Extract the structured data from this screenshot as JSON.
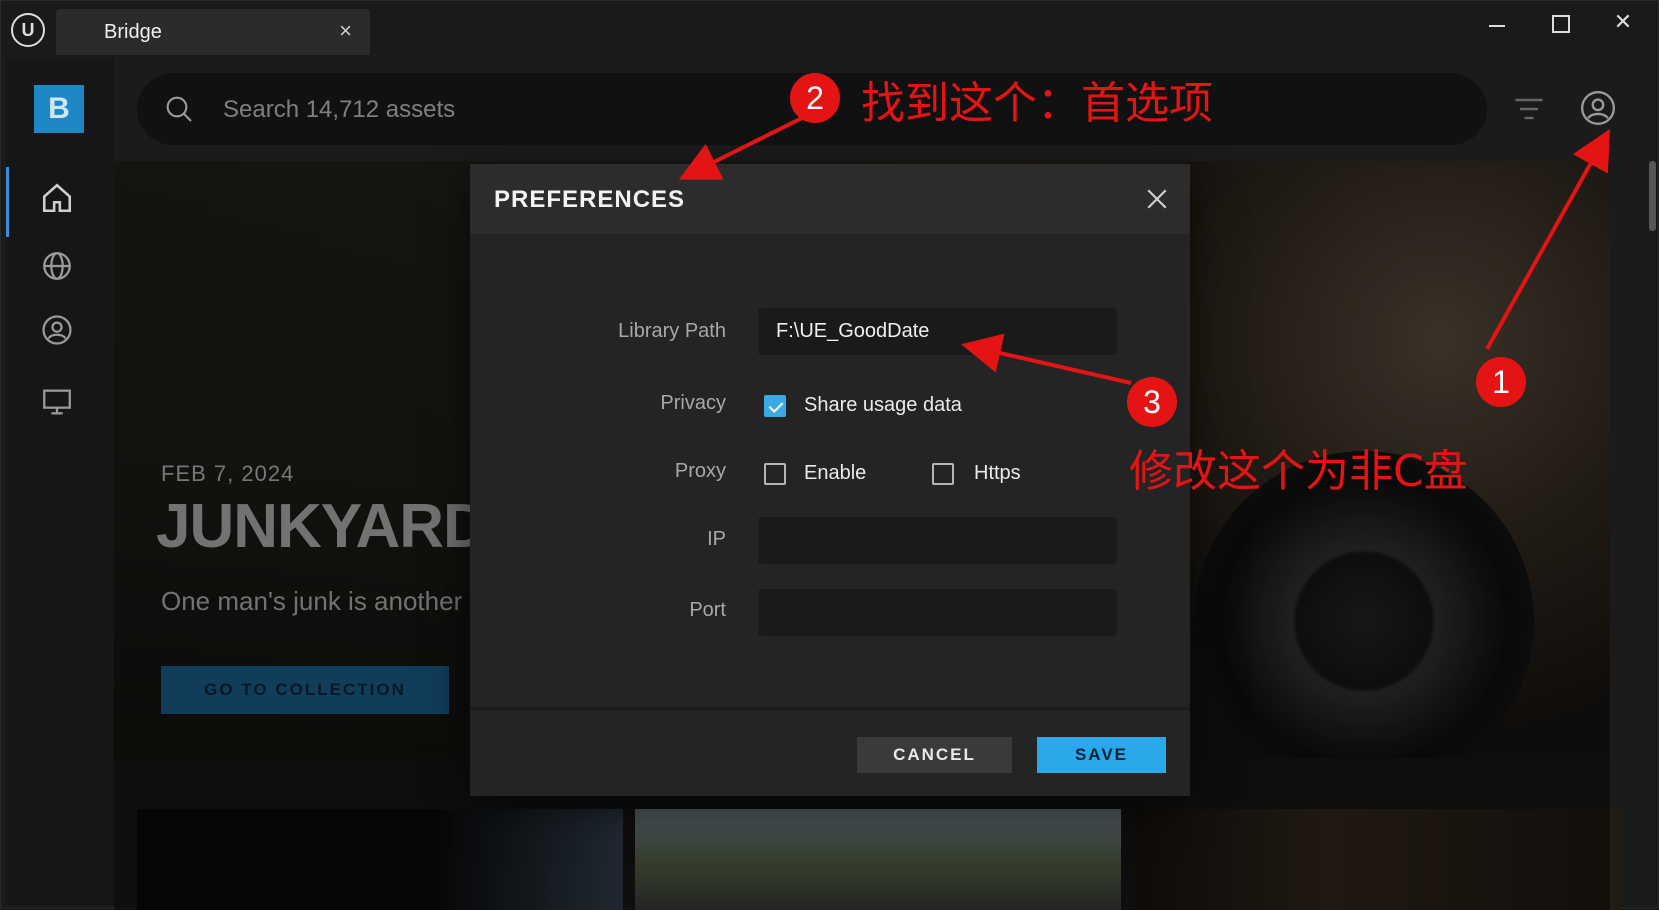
{
  "window": {
    "tab_title": "Bridge",
    "tab_close": "×",
    "close_glyph": "✕"
  },
  "sidebar": {
    "brand_letter": "B",
    "items": [
      {
        "icon": "home-icon"
      },
      {
        "icon": "globe-icon"
      },
      {
        "icon": "user-circle-icon"
      },
      {
        "icon": "monitor-icon"
      }
    ]
  },
  "search": {
    "placeholder": "Search 14,712 assets"
  },
  "hero": {
    "date": "FEB 7, 2024",
    "title": "JUNKYARD W",
    "subtitle": "One man's junk is another m",
    "cta": "GO TO COLLECTION"
  },
  "preferences": {
    "title": "PREFERENCES",
    "library_path_label": "Library Path",
    "library_path_value": "F:\\UE_GoodDate",
    "privacy_label": "Privacy",
    "share_usage_label": "Share usage data",
    "share_usage_checked": true,
    "proxy_label": "Proxy",
    "enable_label": "Enable",
    "enable_checked": false,
    "https_label": "Https",
    "https_checked": false,
    "ip_label": "IP",
    "ip_value": "",
    "port_label": "Port",
    "port_value": "",
    "cancel_label": "CANCEL",
    "save_label": "SAVE"
  },
  "annotations": {
    "step1": "1",
    "step2": "2",
    "step3": "3",
    "note2": "找到这个：首选项",
    "note3": "修改这个为非C盘",
    "color": "#e51414"
  },
  "colors": {
    "accent": "#2aa8ea",
    "brand": "#1e88c7",
    "background": "#1b1b1b"
  }
}
